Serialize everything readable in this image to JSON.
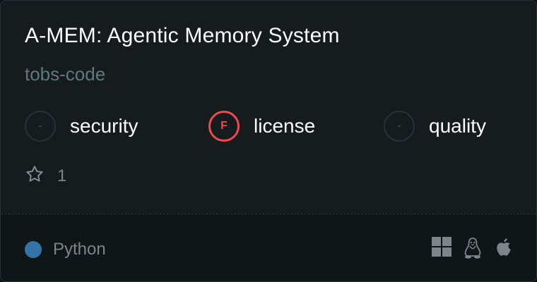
{
  "card": {
    "title": "A-MEM: Agentic Memory System",
    "owner": "tobs-code",
    "metrics": [
      {
        "grade": "-",
        "label": "security"
      },
      {
        "grade": "F",
        "label": "license"
      },
      {
        "grade": "-",
        "label": "quality"
      }
    ],
    "stars": "1",
    "language": {
      "name": "Python",
      "color": "#3572a5"
    },
    "platforms": [
      "windows-icon",
      "linux-icon",
      "apple-icon"
    ]
  },
  "colors": {
    "background": "#161b1e",
    "fail": "#ef4a4f",
    "muted": "#7d8588",
    "owner": "#5f7a77"
  }
}
